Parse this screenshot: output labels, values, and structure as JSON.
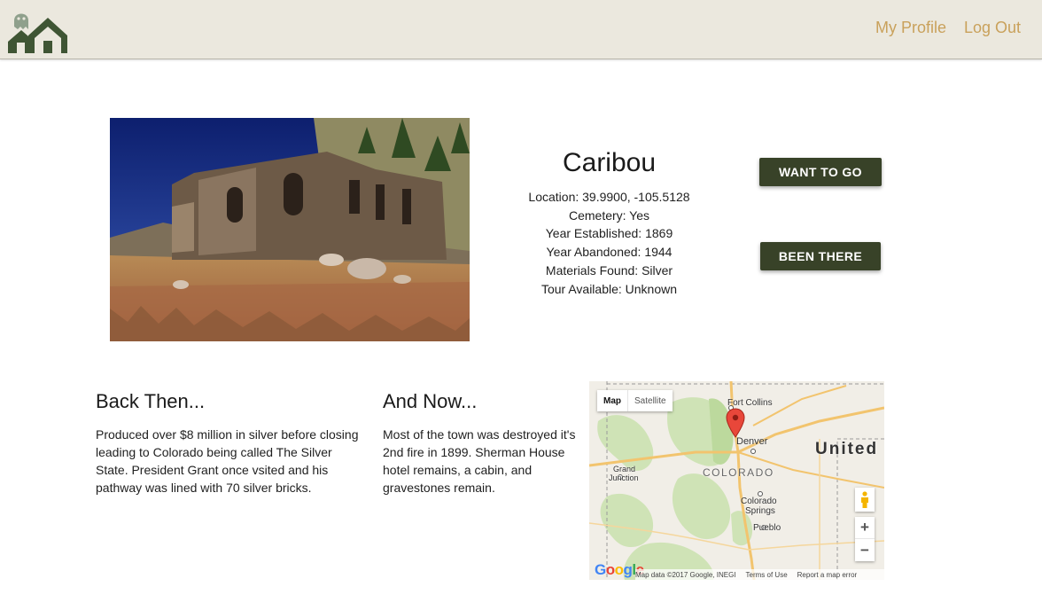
{
  "nav": {
    "logo_icon": "ghost-town-houses-icon",
    "profile_label": "My Profile",
    "logout_label": "Log Out"
  },
  "town": {
    "name": "Caribou",
    "photo_icon": "stone-ruins-photo",
    "facts": [
      "Location: 39.9900, -105.5128",
      "Cemetery: Yes",
      "Year Established: 1869",
      "Year Abandoned: 1944",
      "Materials Found: Silver",
      "Tour Available: Unknown"
    ]
  },
  "actions": {
    "want_label": "WANT TO GO",
    "been_label": "BEEN THERE"
  },
  "back_then": {
    "title": "Back Then...",
    "text": "Produced over $8 million in silver before closing leading to Colorado being called The Silver State. President Grant once vsited and his pathway was lined with 70 silver bricks."
  },
  "and_now": {
    "title": "And Now...",
    "text": "Most of the town was destroyed it's 2nd fire in 1899. Sherman House hotel remains, a cabin, and gravestones remain."
  },
  "map": {
    "type_map": "Map",
    "type_satellite": "Satellite",
    "labels": {
      "fort_collins": "Fort Collins",
      "denver": "Denver",
      "grand": "Grand",
      "junction": "Junction",
      "colorado": "COLORADO",
      "colorado_springs_1": "Colorado",
      "colorado_springs_2": "Springs",
      "pueblo": "Pueblo",
      "united": "United"
    },
    "zoom_in": "+",
    "zoom_out": "−",
    "logo": "Google",
    "footer_data": "Map data ©2017 Google, INEGI",
    "footer_terms": "Terms of Use",
    "footer_report": "Report a map error"
  },
  "colors": {
    "navbar_bg": "#ebe8de",
    "nav_link": "#c9a15b",
    "button_bg": "#384228"
  }
}
